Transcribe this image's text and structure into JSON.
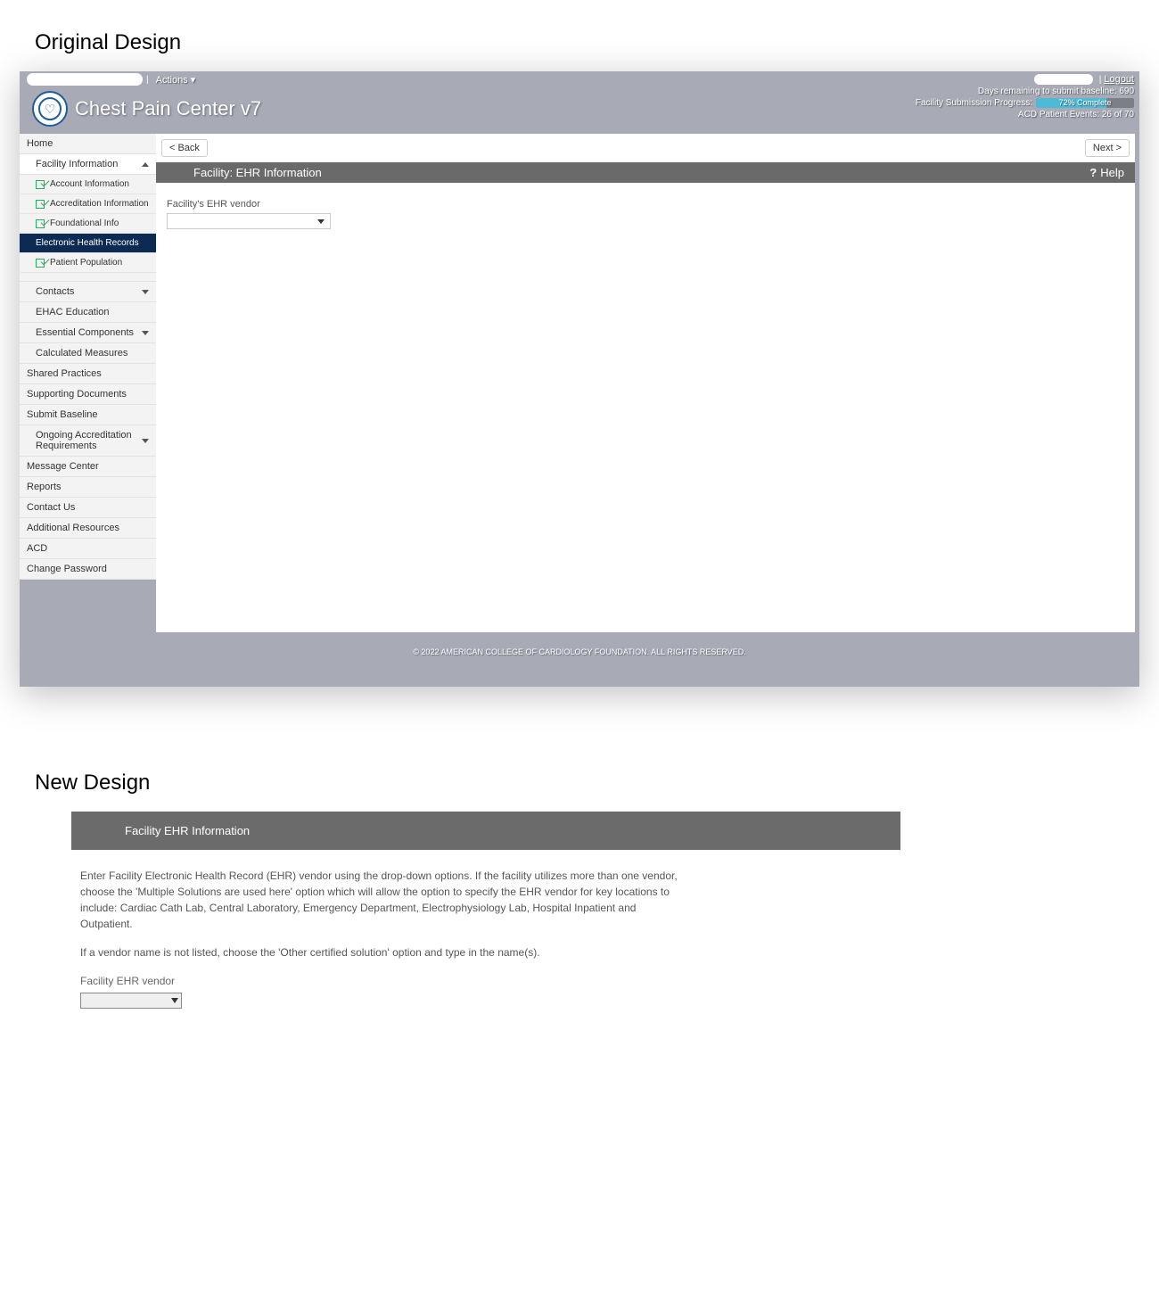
{
  "section_headings": {
    "original": "Original Design",
    "new": "New Design"
  },
  "topbar": {
    "actions_label": "Actions ▾",
    "logout_label": "Logout",
    "days_remaining": "Days remaining to submit baseline: 690",
    "submission_progress_label": "Facility Submission Progress:",
    "progress_text": "72% Complete",
    "acd_events": "ACD Patient Events: 26 of 70",
    "app_title": "Chest Pain Center v7"
  },
  "sidebar": {
    "home": "Home",
    "facility_info": "Facility Information",
    "subs": {
      "account_info": "Account Information",
      "accred_info": "Accreditation Information",
      "foundational": "Foundational Info",
      "ehr": "Electronic Health Records",
      "patient_pop": "Patient Population"
    },
    "contacts": "Contacts",
    "ehac": "EHAC Education",
    "essential": "Essential Components",
    "calc_measures": "Calculated Measures",
    "shared": "Shared Practices",
    "supporting": "Supporting Documents",
    "submit_baseline": "Submit Baseline",
    "ongoing": "Ongoing Accreditation Requirements",
    "message_center": "Message Center",
    "reports": "Reports",
    "contact_us": "Contact Us",
    "additional": "Additional Resources",
    "acd": "ACD",
    "change_pw": "Change Password"
  },
  "main": {
    "back_btn": "< Back",
    "next_btn": "Next >",
    "page_title": "Facility: EHR Information",
    "help_label": "Help",
    "vendor_label": "Facility's EHR vendor"
  },
  "footer": "© 2022 AMERICAN COLLEGE OF CARDIOLOGY FOUNDATION. ALL RIGHTS RESERVED.",
  "new_design": {
    "header": "Facility EHR Information",
    "para1": "Enter Facility Electronic Health Record (EHR) vendor using the drop-down options. If the facility utilizes more than one vendor, choose the 'Multiple Solutions are used here' option which will allow the option to specify the EHR vendor for key locations to include: Cardiac Cath Lab, Central Laboratory, Emergency Department, Electrophysiology Lab, Hospital Inpatient and Outpatient.",
    "para2": "If a vendor name is not listed, choose the 'Other certified solution' option and type in the name(s).",
    "vendor_label": "Facility EHR vendor"
  }
}
